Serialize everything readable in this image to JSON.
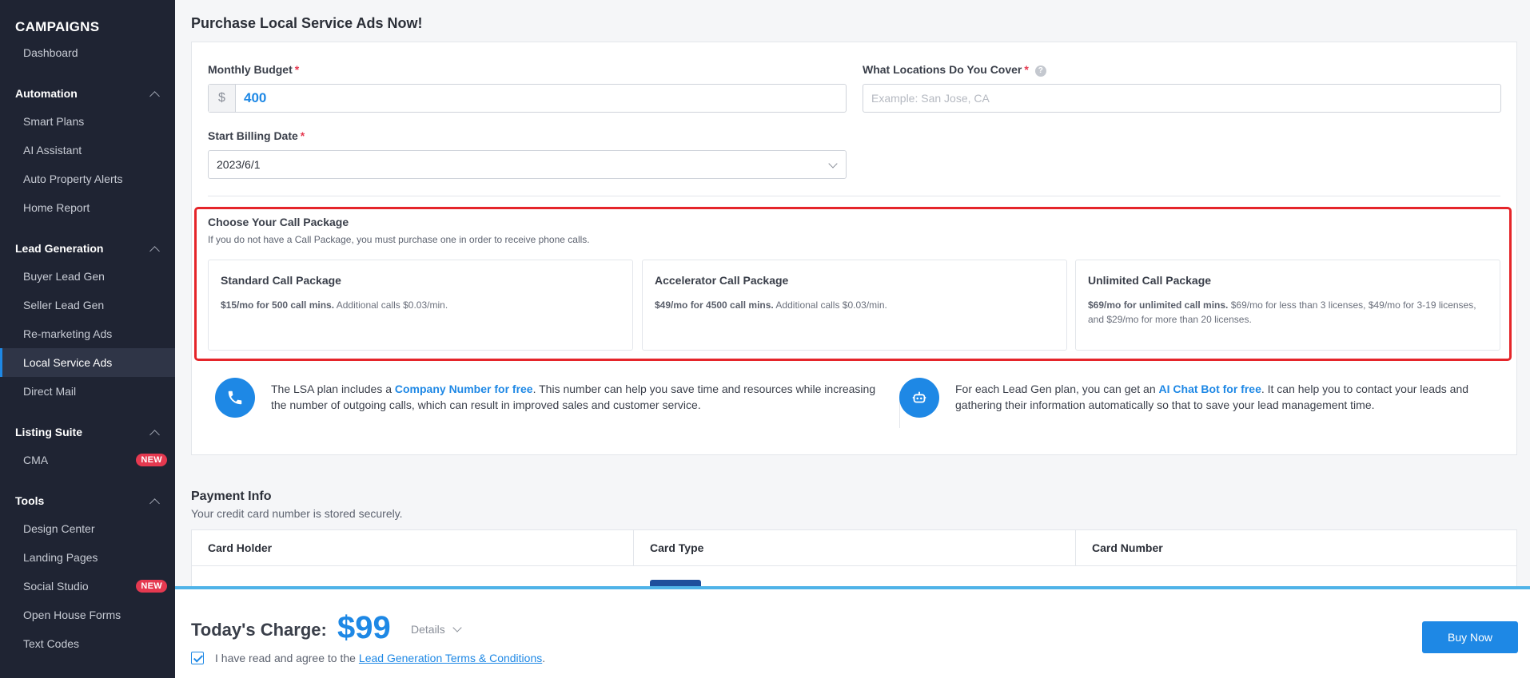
{
  "sidebar": {
    "title": "CAMPAIGNS",
    "top_item": "Dashboard",
    "sections": {
      "automation": {
        "label": "Automation",
        "items": [
          "Smart Plans",
          "AI Assistant",
          "Auto Property Alerts",
          "Home Report"
        ]
      },
      "lead_generation": {
        "label": "Lead Generation",
        "items": [
          "Buyer Lead Gen",
          "Seller Lead Gen",
          "Re-marketing Ads",
          "Local Service Ads",
          "Direct Mail"
        ]
      },
      "listing_suite": {
        "label": "Listing Suite",
        "items": [
          "CMA"
        ],
        "badge": "NEW"
      },
      "tools": {
        "label": "Tools",
        "items": [
          "Design Center",
          "Landing Pages",
          "Social Studio",
          "Open House Forms",
          "Text Codes"
        ],
        "badge": "NEW"
      }
    }
  },
  "page": {
    "title": "Purchase Local Service Ads Now!"
  },
  "form": {
    "budget_label": "Monthly Budget",
    "budget_prefix": "$",
    "budget_value": "400",
    "location_label": "What Locations Do You Cover",
    "location_placeholder": "Example: San Jose, CA",
    "location_help": "?",
    "date_label": "Start Billing Date",
    "date_value": "2023/6/1",
    "required_mark": "*"
  },
  "packages": {
    "title": "Choose Your Call Package",
    "subtitle": "If you do not have a Call Package, you must purchase one in order to receive phone calls.",
    "items": [
      {
        "name": "Standard Call Package",
        "highlight": "$15/mo for 500 call mins.",
        "detail": " Additional calls $0.03/min."
      },
      {
        "name": "Accelerator Call Package",
        "highlight": "$49/mo for 4500 call mins.",
        "detail": " Additional calls $0.03/min."
      },
      {
        "name": "Unlimited Call Package",
        "highlight": "$69/mo for unlimited call mins.",
        "detail": " $69/mo for less than 3 licenses, $49/mo for 3-19 licenses, and $29/mo for more than 20 licenses."
      }
    ]
  },
  "promos": [
    {
      "icon": "phone-icon",
      "pre": "The LSA plan includes a ",
      "link": "Company Number for free",
      "post": ". This number can help you save time and resources while increasing the number of outgoing calls, which can result in improved sales and customer service."
    },
    {
      "icon": "robot-icon",
      "pre": "For each Lead Gen plan, you can get an ",
      "link": "AI Chat Bot for free",
      "post": ". It can help you to contact your leads and gathering their information automatically so that to save your lead management time."
    }
  ],
  "payment": {
    "title": "Payment Info",
    "subtitle": "Your credit card number is stored securely.",
    "columns": [
      "Card Holder",
      "Card Type",
      "Card Number"
    ]
  },
  "footer": {
    "charge_label": "Today's Charge:",
    "charge_amount": "$99",
    "details_label": "Details",
    "agree_text": "I have read and agree to the",
    "agree_link": "Lead Generation Terms & Conditions",
    "agree_end": ".",
    "buy_label": "Buy Now"
  },
  "colors": {
    "accent": "#1e88e5",
    "sidebar_bg": "#1f2433",
    "highlight_border": "#e5252a",
    "badge": "#e53950"
  }
}
